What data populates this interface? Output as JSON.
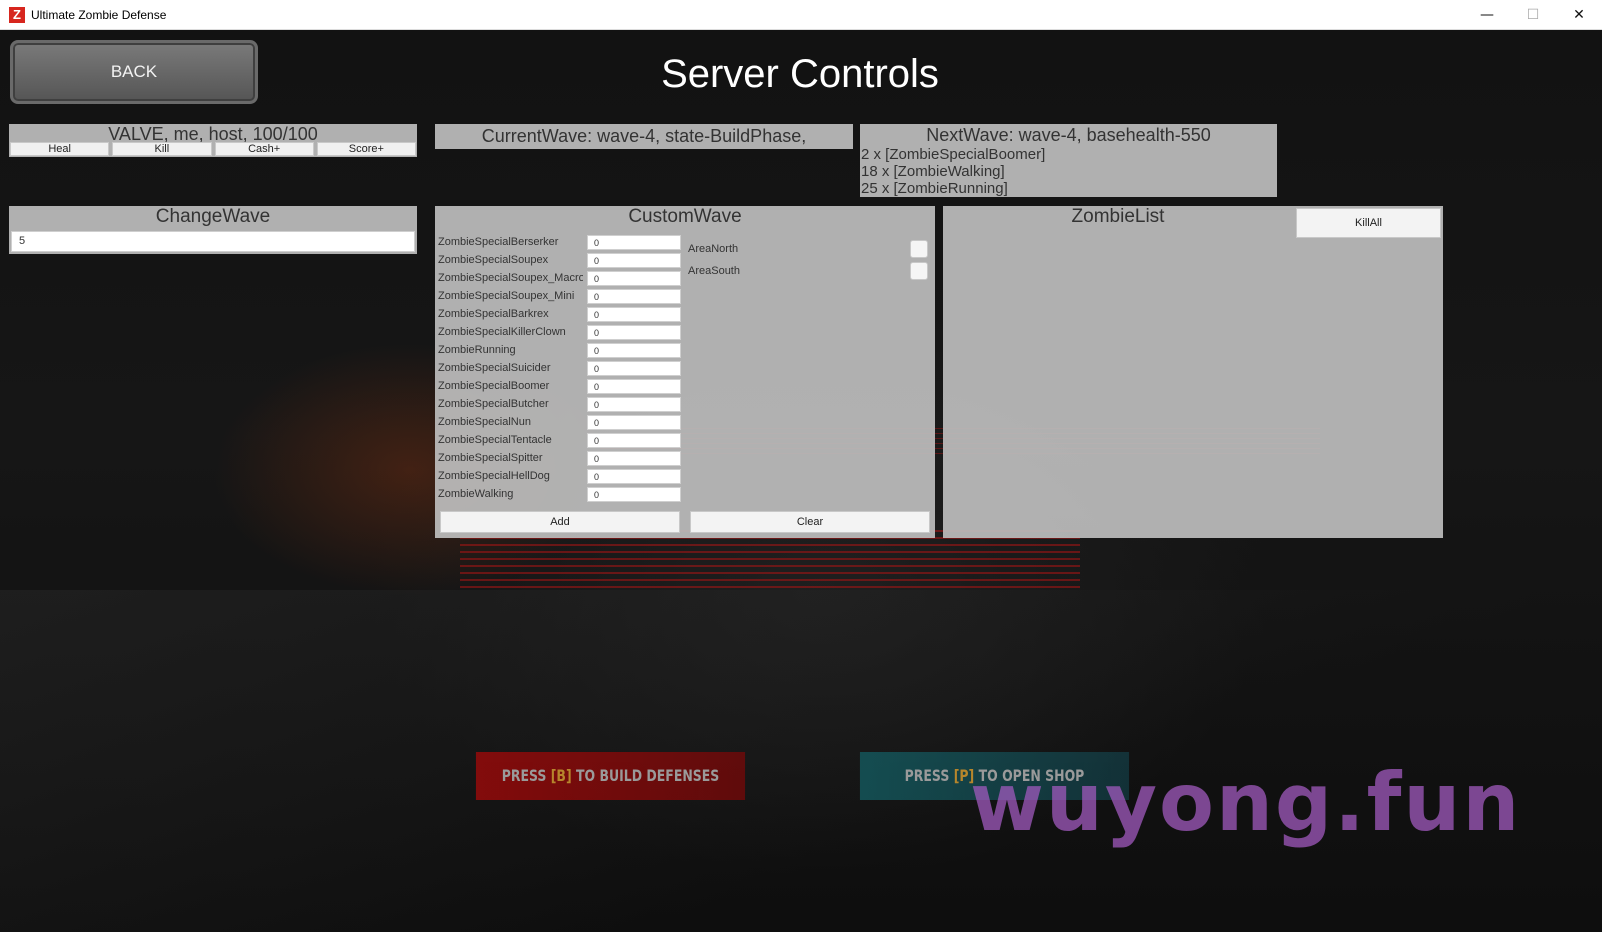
{
  "window": {
    "title": "Ultimate Zombie Defense",
    "icon_letter": "Z",
    "min_glyph": "—",
    "max_glyph": "☐",
    "close_glyph": "✕"
  },
  "header": {
    "back_label": "BACK",
    "page_title": "Server Controls"
  },
  "player_panel": {
    "info": "VALVE, me, host, 100/100",
    "buttons": [
      "Heal",
      "Kill",
      "Cash+",
      "Score+"
    ]
  },
  "current_wave": {
    "text": "CurrentWave: wave-4, state-BuildPhase,"
  },
  "next_wave": {
    "title": "NextWave: wave-4, basehealth-550",
    "lines": [
      "2 x [ZombieSpecialBoomer]",
      "18 x [ZombieWalking]",
      "25 x [ZombieRunning]"
    ]
  },
  "change_wave": {
    "title": "ChangeWave",
    "value": "5"
  },
  "custom_wave": {
    "title": "CustomWave",
    "zombies": [
      {
        "name": "ZombieSpecialBerserker",
        "value": "0"
      },
      {
        "name": "ZombieSpecialSoupex",
        "value": "0"
      },
      {
        "name": "ZombieSpecialSoupex_Macro",
        "value": "0"
      },
      {
        "name": "ZombieSpecialSoupex_Mini",
        "value": "0"
      },
      {
        "name": "ZombieSpecialBarkrex",
        "value": "0"
      },
      {
        "name": "ZombieSpecialKillerClown",
        "value": "0"
      },
      {
        "name": "ZombieRunning",
        "value": "0"
      },
      {
        "name": "ZombieSpecialSuicider",
        "value": "0"
      },
      {
        "name": "ZombieSpecialBoomer",
        "value": "0"
      },
      {
        "name": "ZombieSpecialButcher",
        "value": "0"
      },
      {
        "name": "ZombieSpecialNun",
        "value": "0"
      },
      {
        "name": "ZombieSpecialTentacle",
        "value": "0"
      },
      {
        "name": "ZombieSpecialSpitter",
        "value": "0"
      },
      {
        "name": "ZombieSpecialHellDog",
        "value": "0"
      },
      {
        "name": "ZombieWalking",
        "value": "0"
      }
    ],
    "areas": [
      "AreaNorth",
      "AreaSouth"
    ],
    "add_label": "Add",
    "clear_label": "Clear"
  },
  "zombie_list": {
    "title": "ZombieList",
    "killall_label": "KillAll"
  },
  "prompts": {
    "build_prefix": "PRESS ",
    "build_key": "[B]",
    "build_suffix": " TO BUILD DEFENSES",
    "shop_prefix": "PRESS ",
    "shop_key": "[P]",
    "shop_suffix": " TO OPEN SHOP"
  },
  "watermark": "wuyong.fun"
}
